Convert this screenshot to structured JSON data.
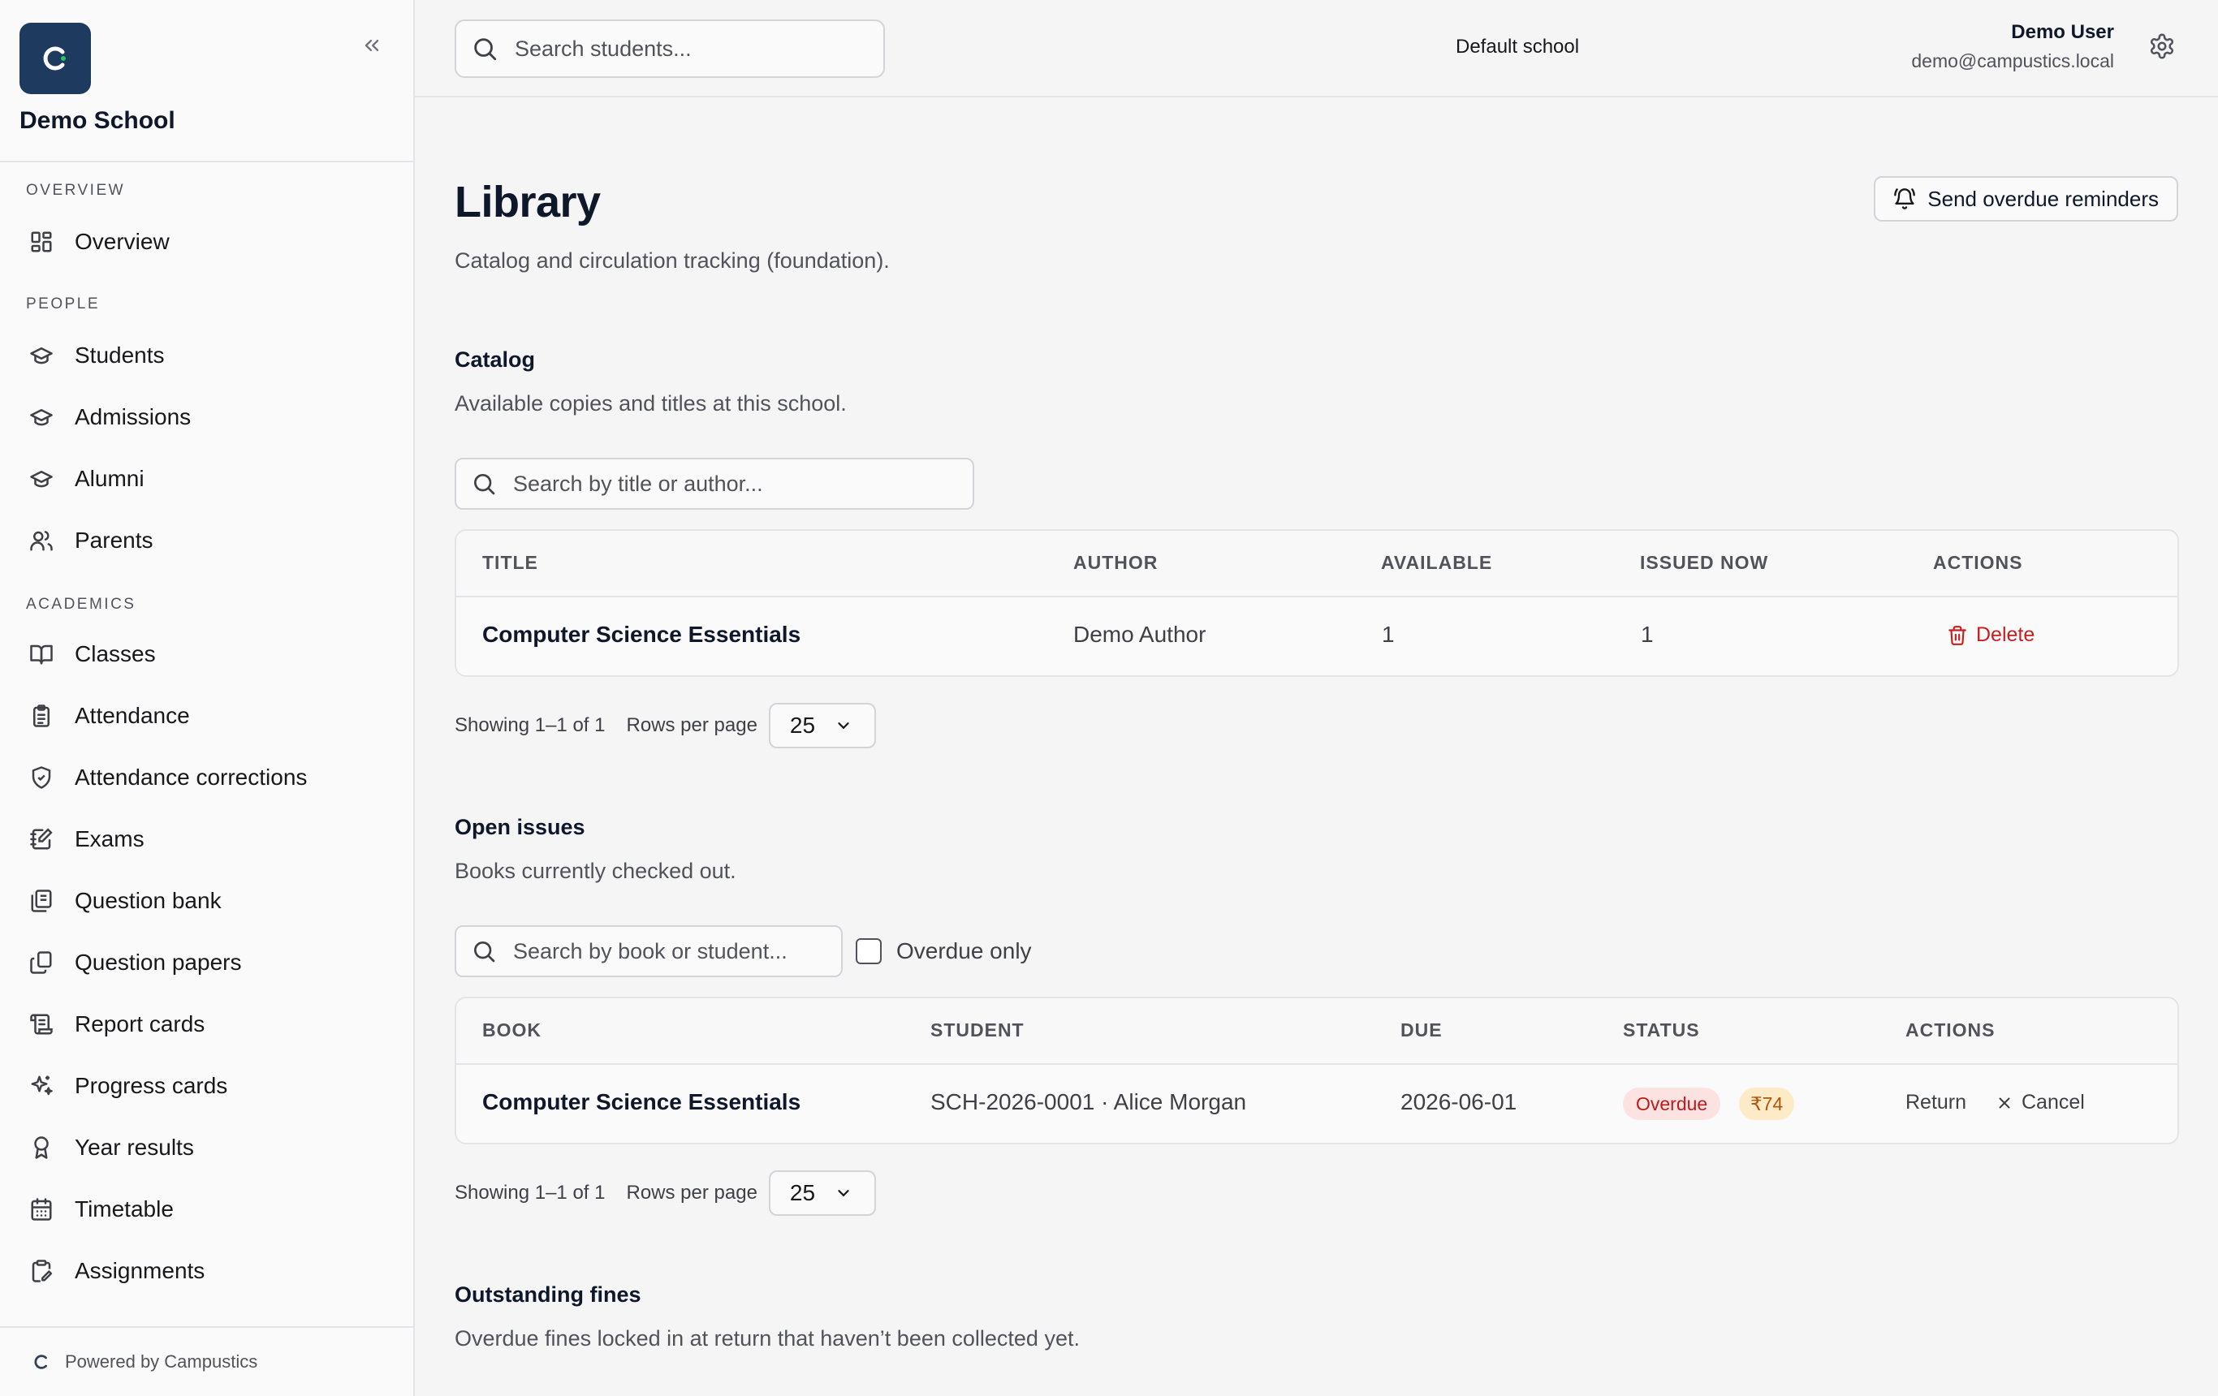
{
  "sidebar": {
    "logo_letter": "C",
    "school_name": "Demo School",
    "sections": [
      {
        "label": "OVERVIEW"
      },
      {
        "label": "PEOPLE"
      },
      {
        "label": "ACADEMICS"
      }
    ],
    "items": [
      {
        "label": "Overview",
        "icon": "layout-dashboard-icon"
      },
      {
        "label": "Students",
        "icon": "graduation-cap-icon"
      },
      {
        "label": "Admissions",
        "icon": "graduation-cap-icon"
      },
      {
        "label": "Alumni",
        "icon": "graduation-cap-icon"
      },
      {
        "label": "Parents",
        "icon": "users-icon"
      },
      {
        "label": "Classes",
        "icon": "book-open-icon"
      },
      {
        "label": "Attendance",
        "icon": "clipboard-list-icon"
      },
      {
        "label": "Attendance corrections",
        "icon": "shield-check-icon"
      },
      {
        "label": "Exams",
        "icon": "notebook-pen-icon"
      },
      {
        "label": "Question bank",
        "icon": "library-icon"
      },
      {
        "label": "Question papers",
        "icon": "copy-icon"
      },
      {
        "label": "Report cards",
        "icon": "scroll-text-icon"
      },
      {
        "label": "Progress cards",
        "icon": "sparkles-icon"
      },
      {
        "label": "Year results",
        "icon": "award-icon"
      },
      {
        "label": "Timetable",
        "icon": "calendar-icon"
      },
      {
        "label": "Assignments",
        "icon": "clipboard-pen-icon"
      }
    ],
    "footer_text": "Powered by Campustics"
  },
  "topbar": {
    "search_placeholder": "Search students...",
    "school_selector": "Default school",
    "user_name": "Demo User",
    "user_email": "demo@campustics.local"
  },
  "page": {
    "title": "Library",
    "subtitle": "Catalog and circulation tracking (foundation).",
    "reminder_button": "Send overdue reminders"
  },
  "catalog": {
    "title": "Catalog",
    "subtitle": "Available copies and titles at this school.",
    "search_placeholder": "Search by title or author...",
    "columns": [
      "TITLE",
      "AUTHOR",
      "AVAILABLE",
      "ISSUED NOW",
      "ACTIONS"
    ],
    "rows": [
      {
        "title": "Computer Science Essentials",
        "author": "Demo Author",
        "available": "1",
        "issued": "1",
        "action": "Delete"
      }
    ],
    "showing": "Showing 1–1 of 1",
    "rows_per_page_label": "Rows per page",
    "rows_per_page": "25"
  },
  "issues": {
    "title": "Open issues",
    "subtitle": "Books currently checked out.",
    "search_placeholder": "Search by book or student...",
    "overdue_only_label": "Overdue only",
    "columns": [
      "BOOK",
      "STUDENT",
      "DUE",
      "STATUS",
      "ACTIONS"
    ],
    "rows": [
      {
        "book": "Computer Science Essentials",
        "student": "SCH-2026-0001 · Alice Morgan",
        "due": "2026-06-01",
        "status": "Overdue",
        "fine": "₹74",
        "return_label": "Return",
        "cancel_label": "Cancel"
      }
    ],
    "showing": "Showing 1–1 of 1",
    "rows_per_page_label": "Rows per page",
    "rows_per_page": "25"
  },
  "fines": {
    "title": "Outstanding fines",
    "subtitle": "Overdue fines locked in at return that haven’t been collected yet."
  },
  "colors": {
    "brand": "#1e3a5f",
    "danger": "#c81e1e",
    "badge_red_bg": "#fde2e2",
    "badge_amber_bg": "#fdebc8"
  }
}
